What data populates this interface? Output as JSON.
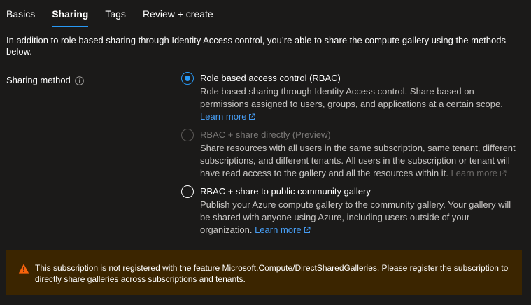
{
  "tabs": [
    {
      "label": "Basics",
      "active": false
    },
    {
      "label": "Sharing",
      "active": true
    },
    {
      "label": "Tags",
      "active": false
    },
    {
      "label": "Review + create",
      "active": false
    }
  ],
  "intro": "In addition to role based sharing through Identity Access control, you’re able to share the compute gallery using the methods below.",
  "sharing_method": {
    "label": "Sharing method",
    "info_icon": "info-icon",
    "options": [
      {
        "title": "Role based access control (RBAC)",
        "description": "Role based sharing through Identity Access control. Share based on permissions assigned to users, groups, and applications at a certain scope.",
        "link": "Learn more",
        "selected": true,
        "disabled": false
      },
      {
        "title": "RBAC + share directly (Preview)",
        "description": "Share resources with all users in the same subscription, same tenant, different subscriptions, and different tenants. All users in the subscription or tenant will have read access to the gallery and all the resources within it.",
        "link": "Learn more",
        "selected": false,
        "disabled": true
      },
      {
        "title": "RBAC + share to public community gallery",
        "description": "Publish your Azure compute gallery to the community gallery. Your gallery will be shared with anyone using Azure, including users outside of your organization.",
        "link": "Learn more",
        "selected": false,
        "disabled": false
      }
    ]
  },
  "warning": {
    "icon": "warning-icon",
    "text": "This subscription is not registered with the feature Microsoft.Compute/DirectSharedGalleries. Please register the subscription to directly share galleries across subscriptions and tenants."
  },
  "colors": {
    "background": "#1b1a19",
    "accent": "#2899f5",
    "link": "#479ef5",
    "warning_background": "#3b2500",
    "warning_icon": "#f7630c"
  }
}
